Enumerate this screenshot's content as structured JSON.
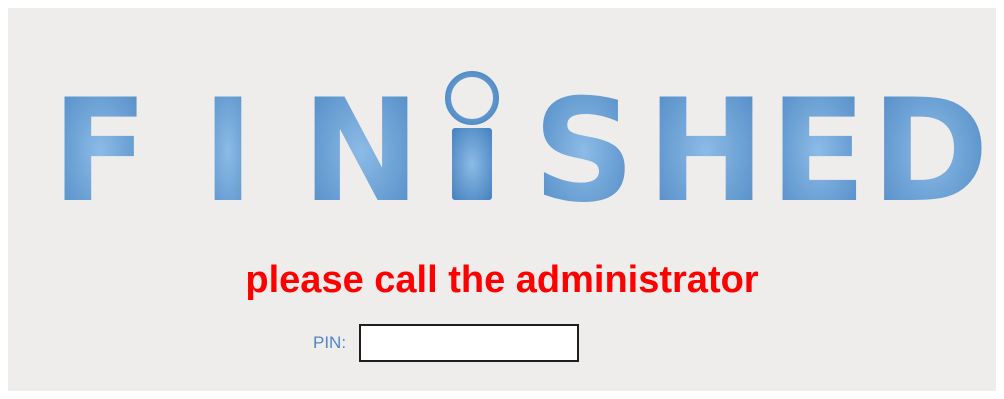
{
  "logo": {
    "letters": [
      "F",
      "I",
      "N",
      "i",
      "S",
      "H",
      "E",
      "D"
    ],
    "color_light": "#7fb0df",
    "color_dark": "#4a85c2"
  },
  "message": "please call the administrator",
  "pin": {
    "label": "PIN:",
    "value": ""
  },
  "colors": {
    "background": "#eeedeb",
    "message": "#ff0000",
    "label": "#4f86c6"
  }
}
